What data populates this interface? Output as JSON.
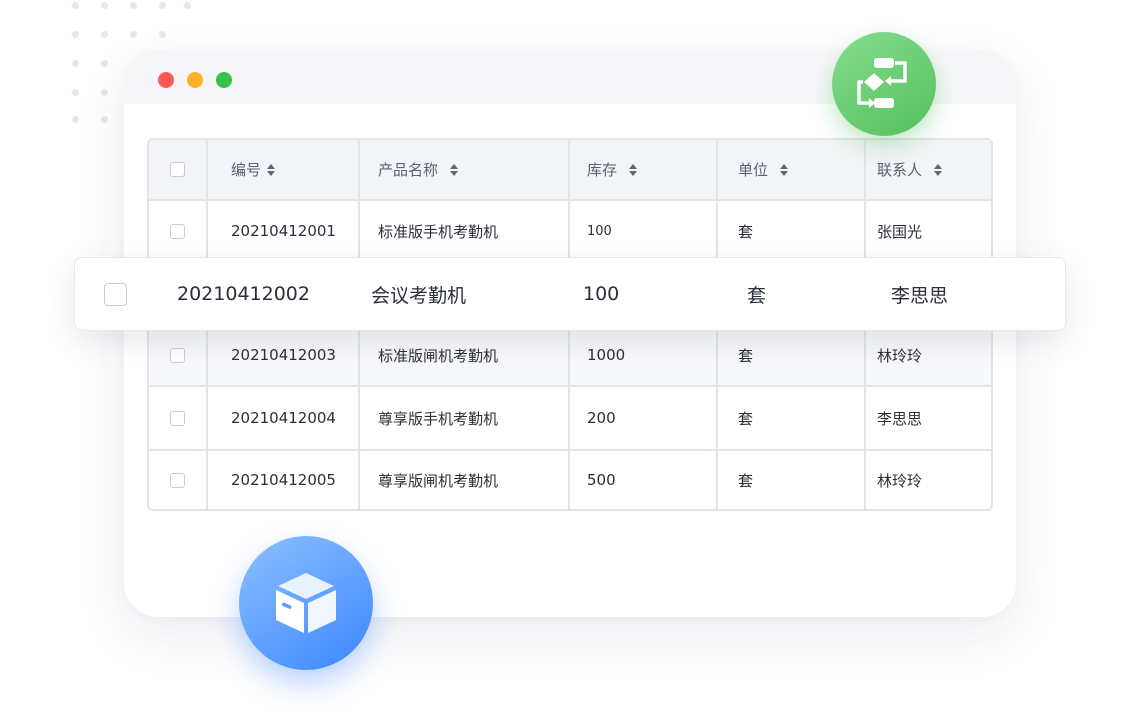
{
  "window": {
    "traffic_lights": [
      "close",
      "minimize",
      "maximize"
    ]
  },
  "table": {
    "columns": [
      {
        "label": "编号"
      },
      {
        "label": "产品名称"
      },
      {
        "label": "库存"
      },
      {
        "label": "单位"
      },
      {
        "label": "联系人"
      }
    ],
    "rows": [
      {
        "id": "20210412001",
        "name": "标准版手机考勤机",
        "stock": "100",
        "unit": "套",
        "contact": "张国光"
      },
      {
        "id": "20210412002",
        "name": "会议考勤机",
        "stock": "100",
        "unit": "套",
        "contact": "李思思"
      },
      {
        "id": "20210412003",
        "name": "标准版闸机考勤机",
        "stock": "1000",
        "unit": "套",
        "contact": "林玲玲"
      },
      {
        "id": "20210412004",
        "name": "尊享版手机考勤机",
        "stock": "200",
        "unit": "套",
        "contact": "李思思"
      },
      {
        "id": "20210412005",
        "name": "尊享版闸机考勤机",
        "stock": "500",
        "unit": "套",
        "contact": "林玲玲"
      }
    ]
  },
  "icons": {
    "flow_badge": "flowchart-icon",
    "box_badge": "package-box-icon"
  },
  "colors": {
    "accent_green": "#55c05c",
    "accent_blue": "#3c86ff",
    "traffic_red": "#fd5a55",
    "traffic_yellow": "#fdb22b",
    "traffic_green": "#33c14a"
  }
}
